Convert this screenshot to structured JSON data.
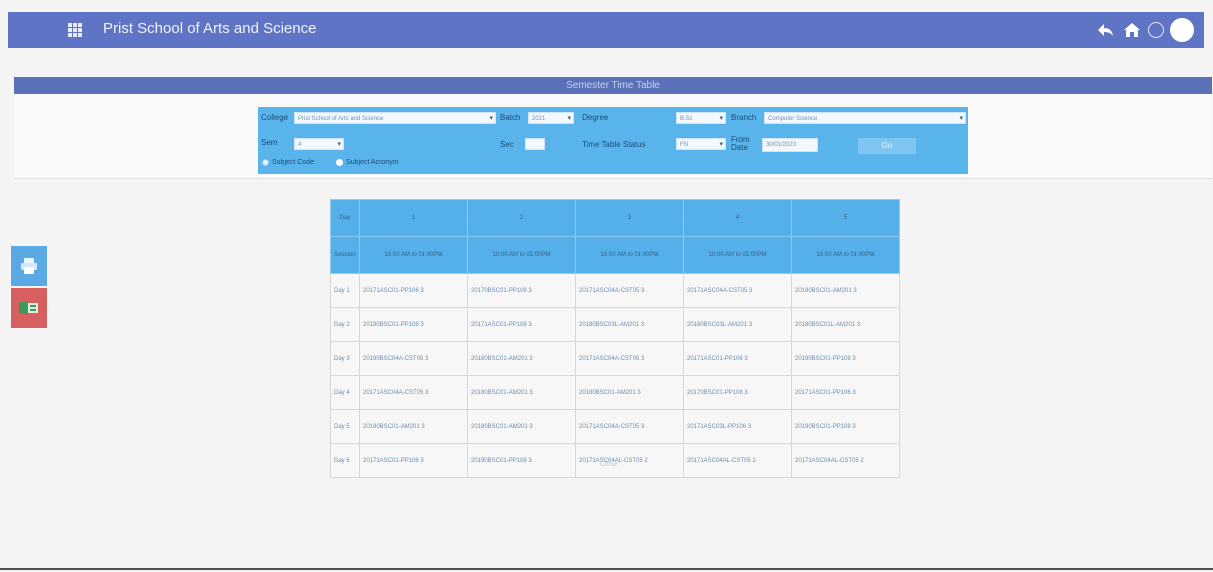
{
  "header": {
    "title": "Prist School of Arts and Science",
    "icons": [
      "grid-icon",
      "back-icon",
      "home-icon",
      "circle-icon",
      "avatar"
    ]
  },
  "section": {
    "title": "Semester Time Table"
  },
  "filters": {
    "college_label": "College",
    "college_value": "Prist School of Arts and Science",
    "batch_label": "Batch",
    "batch_value": "2021",
    "degree_label": "Degree",
    "degree_value": "B.Sc",
    "branch_label": "Branch",
    "branch_value": "Computer Science",
    "sem_label": "Sem",
    "sem_value": "4",
    "sec_label": "Sec",
    "sec_value": "",
    "tt_status_label": "Time Table Status",
    "tt_status_value": "FN",
    "from_date_label": "From Date",
    "from_date_value": "30/01/2023",
    "go_label": "Go",
    "radio1_label": "Subject Code",
    "radio2_label": "Subject Acronym"
  },
  "table": {
    "header_row1": [
      "Day",
      "1",
      "2",
      "3",
      "4",
      "5"
    ],
    "header_row2": [
      "Session",
      "10:00 AM to 01:00PM",
      "10:00 AM to 01:00PM",
      "10:00 AM to 01:00PM",
      "10:00 AM to 01:00PM",
      "10:00 AM to 01:00PM"
    ],
    "rows": [
      [
        "Day 1",
        "20171ASC01-PP106 3",
        "20170BSC01-PP108 3",
        "20171ASC04A-CST05 3",
        "20171ASC04A-CST05 3",
        "20180BSC01-AM201 3"
      ],
      [
        "Day 2",
        "20190BSC01-PP108 3",
        "20171ASC01-PP108 3",
        "20180BSC03L-AM201 3",
        "20180BSC03L-AM201 3",
        "20180BSC01L-AM201 3"
      ],
      [
        "Day 3",
        "20190BSC04A-CST05 3",
        "20180BSC01-AM201 3",
        "20171ASC04A-CST05 3",
        "20171ASC01-PP106 3",
        "20190BSC01-PP108 3"
      ],
      [
        "Day 4",
        "20171ASC04A-CST05 3",
        "20180BSC01-AM201 3",
        "20180BSC01-AM201 3",
        "20170BSC01-PP108 3",
        "20171ASC01-PP106 3"
      ],
      [
        "Day 5",
        "20180BSC01-AM201 3",
        "20180BSC01-AM201 3",
        "20171ASC04A-CST05 3",
        "20171ASC03L-PP106 3",
        "20190BSC01-PP108 3"
      ],
      [
        "Day 6",
        "20171ASC01-PP106 3",
        "20190BSC01-PP108 3",
        "20171ASC04AL-CST05 2",
        "20171ASC04AL-CST05 2",
        "20171ASC04AL-CST05 2"
      ]
    ]
  },
  "close_label": "Close"
}
